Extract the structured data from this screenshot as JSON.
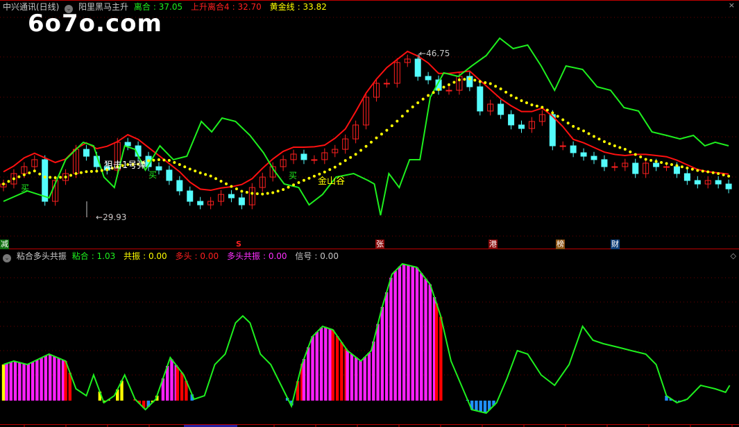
{
  "top_header": {
    "stock": "中兴通讯(日线)",
    "indicator": "阳里黑马主升",
    "items": [
      {
        "label": "离合",
        "value": "37.05",
        "color": "#1ef01e"
      },
      {
        "label": "上升离合4",
        "value": "32.70",
        "color": "#ff2020"
      },
      {
        "label": "黄金线",
        "value": "33.82",
        "color": "#ffff00"
      }
    ]
  },
  "watermark": "6o7o.com",
  "bottom_header": {
    "indicator": "粘合多头共振",
    "items": [
      {
        "label": "粘合",
        "value": "1.03",
        "color": "#1ef01e"
      },
      {
        "label": "共振",
        "value": "0.00",
        "color": "#ffff00"
      },
      {
        "label": "多头",
        "value": "0.00",
        "color": "#ff2020"
      },
      {
        "label": "多头共振",
        "value": "0.00",
        "color": "#ff30ff"
      },
      {
        "label": "信号",
        "value": "0.00",
        "color": "#c8c8c8"
      }
    ]
  },
  "annotations": {
    "low": "29.93",
    "high": "46.75",
    "signal": "狙击1号弹",
    "buy": "买",
    "valley": "金山谷"
  },
  "markers": [
    {
      "text": "减",
      "bg": "#107010"
    },
    {
      "text": "S",
      "bg": "#000"
    },
    {
      "text": "张",
      "bg": "#8a0a0a"
    },
    {
      "text": "港",
      "bg": "#8a0a0a"
    },
    {
      "text": "榜",
      "bg": "#8a5010"
    },
    {
      "text": "财",
      "bg": "#10407a"
    }
  ],
  "icons": {
    "close": "×",
    "expand": "◇"
  },
  "chart_data": {
    "type": "candlestick",
    "price_range": [
      29.93,
      46.75
    ],
    "closes": [
      33.35,
      34.42,
      35.13,
      35.85,
      31.57,
      33.71,
      34.42,
      36.91,
      36.2,
      35.13,
      34.78,
      37.63,
      37.27,
      36.2,
      35.13,
      34.78,
      33.71,
      32.64,
      31.57,
      31.21,
      31.57,
      32.28,
      31.93,
      31.21,
      32.99,
      34.06,
      35.13,
      35.85,
      36.42,
      35.85,
      35.85,
      36.56,
      36.91,
      37.98,
      39.41,
      42.26,
      43.69,
      43.69,
      45.82,
      46.18,
      44.4,
      44.04,
      42.97,
      42.97,
      44.4,
      43.33,
      40.84,
      41.55,
      40.48,
      39.41,
      39.05,
      39.77,
      40.48,
      37.27,
      37.27,
      36.56,
      36.2,
      35.85,
      35.13,
      35.13,
      35.49,
      34.42,
      35.49,
      35.13,
      35.13,
      34.42,
      33.71,
      33.35,
      33.71,
      33.35,
      32.85
    ],
    "green_line": [
      [
        0,
        31.57
      ],
      [
        2.3,
        32.64
      ],
      [
        4.4,
        31.93
      ],
      [
        6.0,
        35.85
      ],
      [
        7.7,
        37.63
      ],
      [
        8.7,
        37.27
      ],
      [
        9.7,
        34.06
      ],
      [
        10.7,
        32.99
      ],
      [
        11.7,
        37.27
      ],
      [
        12.7,
        36.91
      ],
      [
        13.7,
        34.78
      ],
      [
        15.1,
        37.27
      ],
      [
        16.4,
        35.85
      ],
      [
        17.7,
        36.2
      ],
      [
        19.1,
        39.77
      ],
      [
        20.1,
        38.7
      ],
      [
        21.1,
        40.12
      ],
      [
        22.4,
        39.77
      ],
      [
        23.8,
        38.34
      ],
      [
        25.1,
        36.56
      ],
      [
        26.1,
        34.78
      ],
      [
        27.1,
        33.35
      ],
      [
        28.5,
        32.99
      ],
      [
        29.5,
        31.21
      ],
      [
        30.8,
        32.28
      ],
      [
        32.1,
        34.06
      ],
      [
        33.8,
        34.42
      ],
      [
        35.2,
        33.71
      ],
      [
        35.8,
        33.35
      ],
      [
        36.4,
        30.14
      ],
      [
        37.2,
        34.42
      ],
      [
        38.2,
        32.99
      ],
      [
        39.2,
        35.85
      ],
      [
        40.2,
        35.85
      ],
      [
        41.2,
        42.26
      ],
      [
        42.5,
        44.76
      ],
      [
        43.9,
        44.4
      ],
      [
        45.2,
        45.47
      ],
      [
        46.6,
        46.54
      ],
      [
        47.9,
        48.32
      ],
      [
        49.2,
        47.25
      ],
      [
        50.6,
        47.61
      ],
      [
        51.9,
        45.47
      ],
      [
        53.2,
        42.97
      ],
      [
        54.3,
        45.47
      ],
      [
        55.9,
        45.11
      ],
      [
        57.3,
        43.33
      ],
      [
        58.6,
        42.97
      ],
      [
        59.9,
        41.19
      ],
      [
        61.3,
        40.84
      ],
      [
        62.6,
        38.7
      ],
      [
        64.0,
        38.34
      ],
      [
        65.3,
        37.98
      ],
      [
        66.6,
        38.34
      ],
      [
        67.7,
        37.27
      ],
      [
        68.7,
        37.63
      ],
      [
        70,
        37.27
      ]
    ],
    "osc_line": [
      [
        0,
        26
      ],
      [
        1.0,
        28.5
      ],
      [
        2.3,
        26
      ],
      [
        4.4,
        33.5
      ],
      [
        6.0,
        28.5
      ],
      [
        7.0,
        8.5
      ],
      [
        8.0,
        3.5
      ],
      [
        8.7,
        18.5
      ],
      [
        9.7,
        -1.5
      ],
      [
        10.7,
        3.5
      ],
      [
        11.7,
        18.5
      ],
      [
        12.7,
        1
      ],
      [
        13.7,
        -6.5
      ],
      [
        14.7,
        1
      ],
      [
        16.1,
        31
      ],
      [
        17.4,
        18.5
      ],
      [
        18.4,
        1
      ],
      [
        19.4,
        3.5
      ],
      [
        20.4,
        26
      ],
      [
        21.4,
        33.5
      ],
      [
        22.4,
        56
      ],
      [
        23.1,
        61
      ],
      [
        23.8,
        56
      ],
      [
        24.8,
        33.5
      ],
      [
        25.8,
        26
      ],
      [
        26.8,
        11
      ],
      [
        27.8,
        -4
      ],
      [
        28.8,
        26
      ],
      [
        29.8,
        46
      ],
      [
        30.8,
        53.5
      ],
      [
        31.8,
        51
      ],
      [
        33.2,
        36
      ],
      [
        34.5,
        28.5
      ],
      [
        35.5,
        36
      ],
      [
        36.5,
        66
      ],
      [
        37.5,
        91
      ],
      [
        38.5,
        98.5
      ],
      [
        39.9,
        96
      ],
      [
        41.2,
        83.5
      ],
      [
        42.2,
        61
      ],
      [
        43.2,
        28.5
      ],
      [
        44.2,
        11
      ],
      [
        45.2,
        -6.5
      ],
      [
        46.6,
        -9
      ],
      [
        47.6,
        -1.5
      ],
      [
        48.6,
        16
      ],
      [
        49.6,
        36
      ],
      [
        50.6,
        33.5
      ],
      [
        51.9,
        18.5
      ],
      [
        53.2,
        11
      ],
      [
        54.6,
        26
      ],
      [
        55.9,
        53.5
      ],
      [
        56.9,
        43.5
      ],
      [
        57.9,
        41
      ],
      [
        59.3,
        38.5
      ],
      [
        60.6,
        36
      ],
      [
        62.0,
        33.5
      ],
      [
        63.0,
        26
      ],
      [
        64.0,
        3.5
      ],
      [
        65.0,
        -1.5
      ],
      [
        66.0,
        1
      ],
      [
        67.3,
        11
      ],
      [
        68.7,
        8.5
      ],
      [
        69.7,
        6
      ],
      [
        70.1,
        11
      ]
    ],
    "bar_segments": [
      [
        0,
        0.3,
        "#ffff00"
      ],
      [
        0.3,
        6.0,
        "#ff20ff"
      ],
      [
        6.0,
        6.7,
        "#ff0000"
      ],
      [
        9.3,
        10.4,
        "#ffff00"
      ],
      [
        11.0,
        11.6,
        "#ffff00"
      ],
      [
        12.7,
        14.0,
        "#ff0000"
      ],
      [
        14.0,
        14.4,
        "#2090ff"
      ],
      [
        14.4,
        15.2,
        "#ffff00"
      ],
      [
        15.4,
        16.8,
        "#ff20ff"
      ],
      [
        16.8,
        17.9,
        "#ff0000"
      ],
      [
        18.2,
        18.6,
        "#2090ff"
      ],
      [
        27.4,
        28.0,
        "#2090ff"
      ],
      [
        28.4,
        29.0,
        "#ff0000"
      ],
      [
        29.0,
        31.8,
        "#ff20ff"
      ],
      [
        31.8,
        33.2,
        "#ff0000"
      ],
      [
        33.2,
        41.8,
        "#ff20ff"
      ],
      [
        41.8,
        42.6,
        "#ff0000"
      ],
      [
        44.8,
        47.6,
        "#2090ff"
      ],
      [
        64.0,
        66.0,
        "#2090ff"
      ]
    ],
    "up_color": "#ff2020",
    "down_color": "#54fcfc",
    "ma_color": "#ffff00"
  }
}
